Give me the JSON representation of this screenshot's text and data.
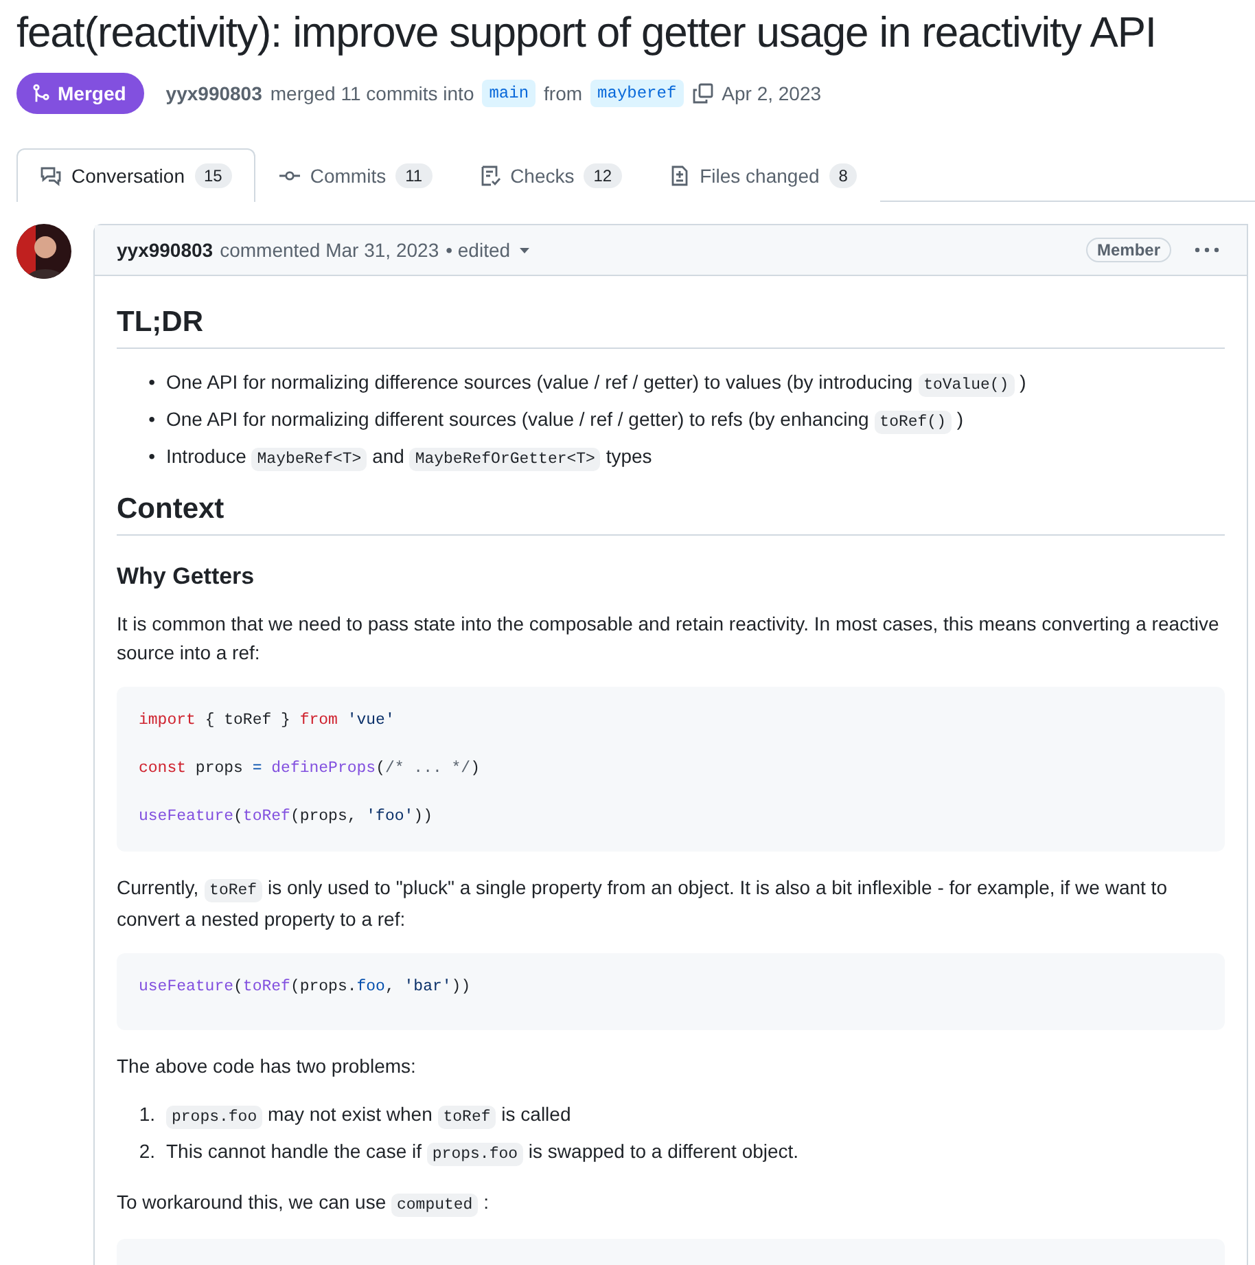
{
  "title": "feat(reactivity): improve support of getter usage in reactivity API",
  "status": {
    "label": "Merged",
    "kind": "merged"
  },
  "merge_info": {
    "author": "yyx990803",
    "text": "merged 11 commits into",
    "base": "main",
    "from_text": "from",
    "head": "mayberef",
    "date": "Apr 2, 2023"
  },
  "tabs": [
    {
      "label": "Conversation",
      "count": "15",
      "selected": true
    },
    {
      "label": "Commits",
      "count": "11",
      "selected": false
    },
    {
      "label": "Checks",
      "count": "12",
      "selected": false
    },
    {
      "label": "Files changed",
      "count": "8",
      "selected": false
    }
  ],
  "comment": {
    "author": "yyx990803",
    "action": "commented Mar 31, 2023",
    "edited": "• edited",
    "role": "Member",
    "blocks": [
      {
        "kind": "h1",
        "text": "TL;DR"
      },
      {
        "kind": "list",
        "items": [
          {
            "marker": "•",
            "segments": [
              {
                "kind": "text",
                "text": "One API for normalizing difference sources (value / ref / getter) to values (by introducing"
              },
              {
                "kind": "code",
                "text": "toValue()"
              },
              {
                "kind": "text",
                "text": ")"
              }
            ]
          },
          {
            "marker": "•",
            "segments": [
              {
                "kind": "text",
                "text": "One API for normalizing different sources (value / ref / getter) to refs (by enhancing"
              },
              {
                "kind": "code",
                "text": "toRef()"
              },
              {
                "kind": "text",
                "text": ")"
              }
            ]
          },
          {
            "marker": "•",
            "segments": [
              {
                "kind": "text",
                "text": "Introduce"
              },
              {
                "kind": "code",
                "text": "MaybeRef<T>"
              },
              {
                "kind": "text",
                "text": "and"
              },
              {
                "kind": "code",
                "text": "MaybeRefOrGetter<T>"
              },
              {
                "kind": "text",
                "text": "types"
              }
            ]
          }
        ]
      },
      {
        "kind": "h1",
        "text": "Context"
      },
      {
        "kind": "h2",
        "text": "Why Getters"
      },
      {
        "kind": "p",
        "segments": [
          {
            "kind": "text",
            "text": "It is common that we need to pass state into the composable and retain reactivity. In most cases, this means converting a reactive source into a ref:"
          }
        ]
      },
      {
        "kind": "pre",
        "lines": [
          {
            "kind": "code",
            "tokens": [
              {
                "kind": "keyword",
                "text": "import"
              },
              {
                "kind": "plain",
                "text": " { toRef } "
              },
              {
                "kind": "keyword",
                "text": "from"
              },
              {
                "kind": "string",
                "text": " 'vue'"
              }
            ]
          },
          {
            "kind": "blank"
          },
          {
            "kind": "code",
            "tokens": [
              {
                "kind": "keyword",
                "text": "const"
              },
              {
                "kind": "plain",
                "text": " props "
              },
              {
                "kind": "constant",
                "text": "="
              },
              {
                "kind": "func",
                "text": " defineProps"
              },
              {
                "kind": "plain",
                "text": "("
              },
              {
                "kind": "comment",
                "text": "/* ... */"
              },
              {
                "kind": "plain",
                "text": ")"
              }
            ]
          },
          {
            "kind": "blank"
          },
          {
            "kind": "code",
            "tokens": [
              {
                "kind": "func",
                "text": "useFeature"
              },
              {
                "kind": "plain",
                "text": "("
              },
              {
                "kind": "func",
                "text": "toRef"
              },
              {
                "kind": "plain",
                "text": "(props, "
              },
              {
                "kind": "string",
                "text": "'foo'"
              },
              {
                "kind": "plain",
                "text": "))"
              }
            ]
          }
        ]
      },
      {
        "kind": "p",
        "segments": [
          {
            "kind": "text",
            "text": "Currently,"
          },
          {
            "kind": "code",
            "text": "toRef"
          },
          {
            "kind": "text",
            "text": "is only used to \"pluck\" a single property from an object. It is also a bit inflexible - for example, if we want to convert a nested property to a ref:"
          }
        ]
      },
      {
        "kind": "pre",
        "lines": [
          {
            "kind": "code",
            "tokens": [
              {
                "kind": "func",
                "text": "useFeature"
              },
              {
                "kind": "plain",
                "text": "("
              },
              {
                "kind": "func",
                "text": "toRef"
              },
              {
                "kind": "plain",
                "text": "(props."
              },
              {
                "kind": "constant",
                "text": "foo"
              },
              {
                "kind": "plain",
                "text": ", "
              },
              {
                "kind": "string",
                "text": "'bar'"
              },
              {
                "kind": "plain",
                "text": "))"
              }
            ]
          }
        ]
      },
      {
        "kind": "p",
        "segments": [
          {
            "kind": "text",
            "text": "The above code has two problems:"
          }
        ]
      },
      {
        "kind": "list",
        "items": [
          {
            "marker": "1.",
            "segments": [
              {
                "kind": "code",
                "text": "props.foo"
              },
              {
                "kind": "text",
                "text": "may not exist when"
              },
              {
                "kind": "code",
                "text": "toRef"
              },
              {
                "kind": "text",
                "text": "is called"
              }
            ]
          },
          {
            "marker": "2.",
            "segments": [
              {
                "kind": "text",
                "text": "This cannot handle the case if"
              },
              {
                "kind": "code",
                "text": "props.foo"
              },
              {
                "kind": "text",
                "text": "is swapped to a different object."
              }
            ]
          }
        ]
      },
      {
        "kind": "p",
        "segments": [
          {
            "kind": "text",
            "text": "To workaround this, we can use"
          },
          {
            "kind": "code",
            "text": "computed"
          },
          {
            "kind": "text",
            "text": ":"
          }
        ]
      },
      {
        "kind": "pre_cut"
      }
    ]
  }
}
